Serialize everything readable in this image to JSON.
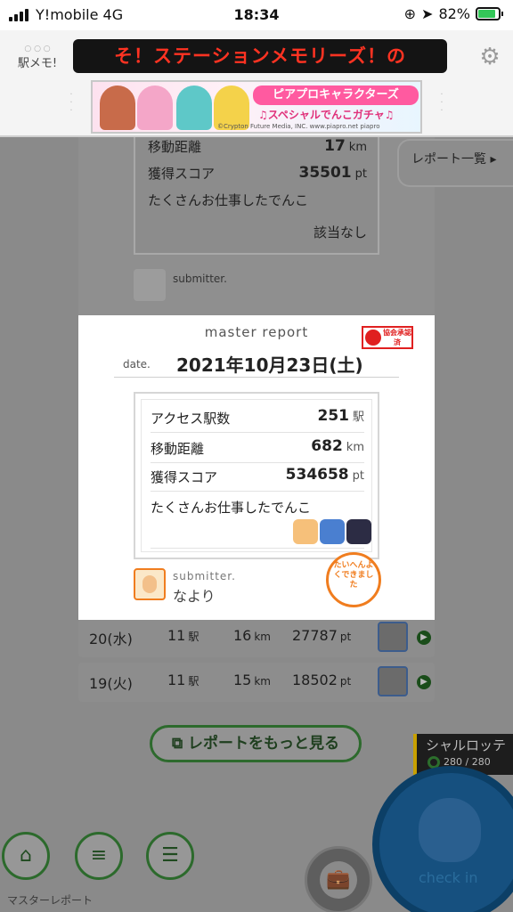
{
  "status_bar": {
    "carrier": "Y!mobile   4G",
    "time": "18:34",
    "battery": "82%"
  },
  "header": {
    "logo": "駅メモ!",
    "ticker": "そ！ステーションメモリーズ！の",
    "banner_title": "ピアプロキャラクターズ",
    "banner_sub": "♫スペシャルでんこガチャ♫",
    "banner_copy": "©Crypton Future Media, INC.  www.piapro.net  piapro"
  },
  "background": {
    "rows": [
      {
        "label": "移動距離",
        "value": "17",
        "unit": "km"
      },
      {
        "label": "獲得スコア",
        "value": "35501",
        "unit": "pt"
      }
    ],
    "comment": "たくさんお仕事したでんこ",
    "none": "該当なし",
    "submitter_label": "submitter.",
    "report_list": "レポート一覧 ▸"
  },
  "days": [
    {
      "day": "20(水)",
      "stations": "11",
      "station_unit": "駅",
      "distance": "16",
      "distance_unit": "km",
      "score": "27787",
      "score_unit": "pt"
    },
    {
      "day": "19(火)",
      "stations": "11",
      "station_unit": "駅",
      "distance": "15",
      "distance_unit": "km",
      "score": "18502",
      "score_unit": "pt"
    }
  ],
  "more_button": "レポートをもっと見る",
  "station_card": {
    "name": "シャルロッテ",
    "hp": "280 / 280"
  },
  "nav": {
    "label": "マスターレポート",
    "checkin": "check in"
  },
  "modal": {
    "heading": "master report",
    "badge": "協会承認済",
    "date_label": "date.",
    "date": "2021年10月23日(土)",
    "stats": [
      {
        "label": "アクセス駅数",
        "value": "251",
        "unit": "駅"
      },
      {
        "label": "移動距離",
        "value": "682",
        "unit": "km"
      },
      {
        "label": "獲得スコア",
        "value": "534658",
        "unit": "pt"
      }
    ],
    "comment": "たくさんお仕事したでんこ",
    "submitter_label": "submitter.",
    "submitter_name": "なより",
    "stamp": "たいへんよくできました"
  },
  "colors": {
    "accent_green": "#2c6a2c",
    "ticker_red": "#ff3322",
    "checkin_blue": "#16507f",
    "stamp_orange": "#f07d1f"
  }
}
